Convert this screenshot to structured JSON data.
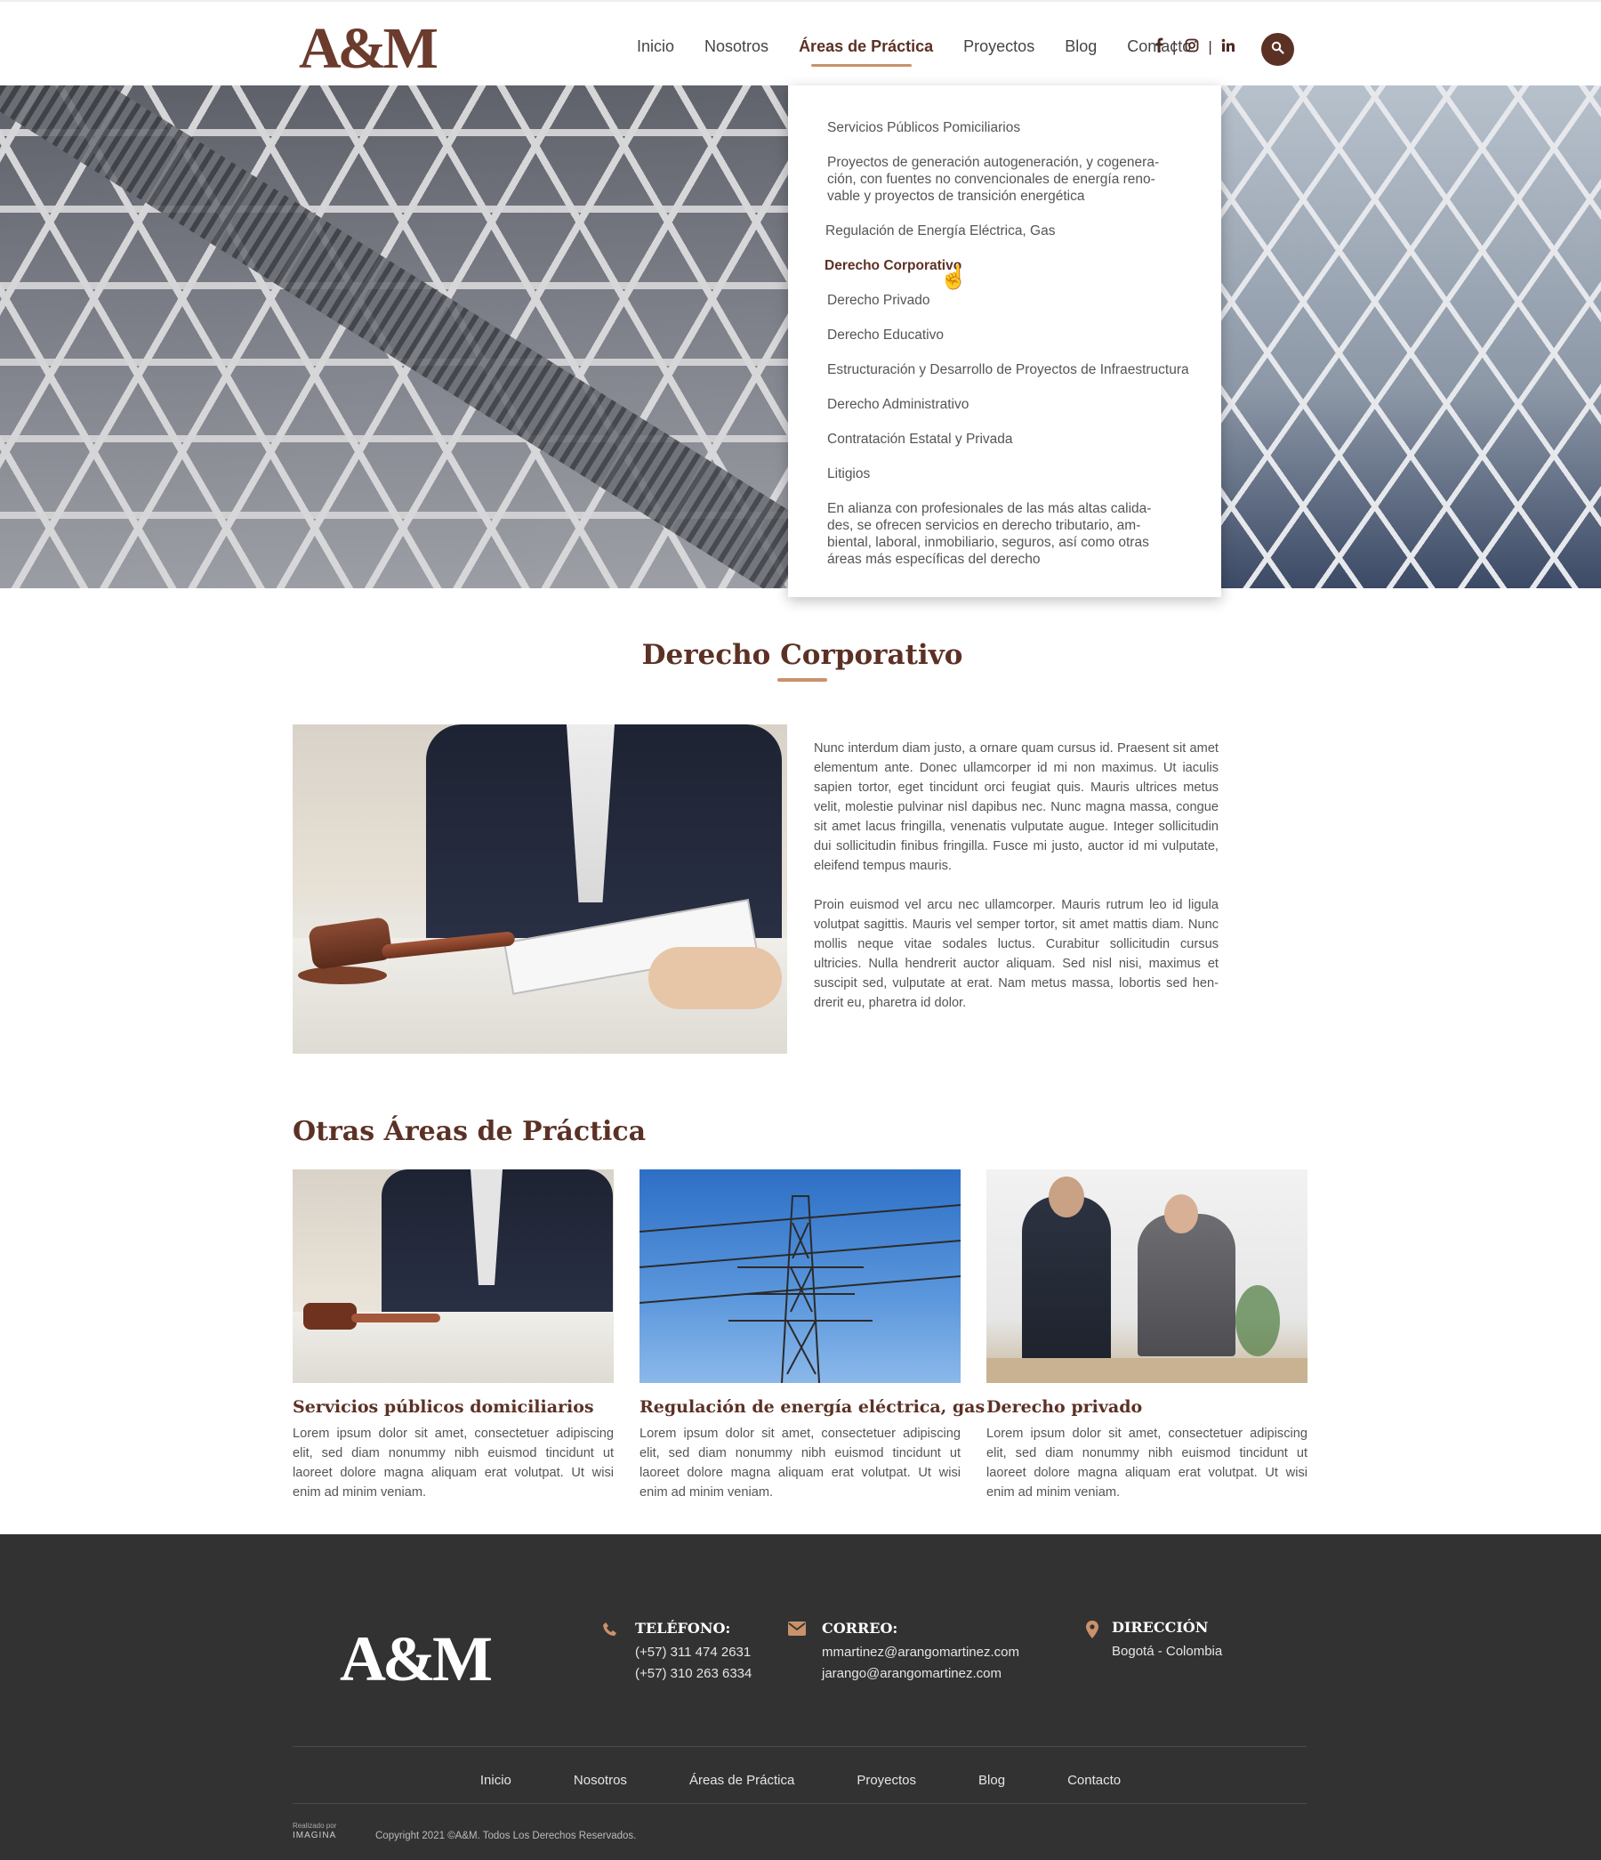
{
  "header": {
    "logo": "A&M",
    "nav": [
      {
        "label": "Inicio"
      },
      {
        "label": "Nosotros"
      },
      {
        "label": "Áreas de Práctica",
        "active": true
      },
      {
        "label": "Proyectos"
      },
      {
        "label": "Blog"
      },
      {
        "label": "Contacto"
      }
    ],
    "social": [
      "facebook-icon",
      "instagram-icon",
      "linkedin-icon"
    ],
    "search_icon": "search-icon"
  },
  "dropdown": {
    "items": [
      "Servicios Públicos Pomiciliarios",
      "Proyectos de generación autogeneración, y cogenera-ción, con fuentes no convencionales de energía reno-vable y proyectos de transición energética",
      "Regulación de Energía Eléctrica, Gas",
      "Derecho Corporativo",
      "Derecho Privado",
      "Derecho Educativo",
      "Estructuración y Desarrollo de Proyectos de Infraestructura",
      "Derecho Administrativo",
      "Contratación Estatal y Privada",
      "Litigios",
      "En alianza con profesionales de las más altas calida-des, se ofrecen servicios en derecho tributario, am-biental, laboral, inmobiliario, seguros, así como otras áreas más específicas del derecho"
    ],
    "active_index": 3
  },
  "main": {
    "title": "Derecho Corporativo",
    "paragraphs": [
      "Nunc interdum diam justo, a ornare quam cursus id. Praesent sit amet elementum ante. Donec ullamcorper id mi non maximus. Ut iaculis sapien tortor, eget tincidunt orci feugiat quis. Mauris ultrices metus velit, molestie pulvinar nisl dapibus nec. Nunc magna massa, congue sit amet lacus fringilla, venenatis vulputate augue. Integer sollicitudin dui sollicitudin finibus fringilla. Fusce mi justo, auctor id mi vulputate, eleifend tempus mauris.",
      "Proin euismod vel arcu nec ullamcorper. Mauris rutrum leo id ligula volutpat sagittis. Mauris vel semper tortor, sit amet mattis diam. Nunc mollis neque vitae sodales luctus. Curabitur sollicitudin cursus ultricies. Nulla hendrerit auctor aliquam. Sed nisl nisi, maximus et suscipit sed, vulputate at erat. Nam metus massa, lobortis sed hen-drerit eu, pharetra id dolor."
    ]
  },
  "others": {
    "title": "Otras Áreas de Práctica",
    "cards": [
      {
        "title": "Servicios públicos domiciliarios",
        "text": "Lorem ipsum dolor sit amet, consectetuer adipiscing elit, sed diam nonummy nibh euismod tincidunt ut laoreet dolore magna aliquam erat volutpat. Ut wisi enim ad minim veniam."
      },
      {
        "title": "Regulación de energía eléctrica, gas",
        "text": "Lorem ipsum dolor sit amet, consectetuer adipiscing elit, sed diam nonummy nibh euismod tincidunt ut laoreet dolore magna aliquam erat volutpat. Ut wisi enim ad minim veniam."
      },
      {
        "title": "Derecho privado",
        "text": "Lorem ipsum dolor sit amet, consectetuer adipiscing elit, sed diam nonummy nibh euismod tincidunt ut laoreet dolore magna aliquam erat volutpat. Ut wisi enim ad minim veniam."
      }
    ]
  },
  "footer": {
    "logo": "A&M",
    "phone": {
      "label": "TELÉFONO:",
      "lines": [
        "(+57) 311 474 2631",
        "(+57) 310 263 6334"
      ]
    },
    "email": {
      "label": "CORREO:",
      "lines": [
        "mmartinez@arangomartinez.com",
        "jarango@arangomartinez.com"
      ]
    },
    "address": {
      "label": "DIRECCIÓN",
      "lines": [
        "Bogotá - Colombia"
      ]
    },
    "nav": [
      "Inicio",
      "Nosotros",
      "Áreas de Práctica",
      "Proyectos",
      "Blog",
      "Contacto"
    ],
    "made_by": "Realizado por",
    "made_brand": "IMAGINA",
    "copyright": "Copyright 2021 ©A&M. Todos Los Derechos Reservados."
  },
  "colors": {
    "brand": "#5c3125",
    "accent": "#c9926b",
    "footer_bg": "#323232"
  }
}
